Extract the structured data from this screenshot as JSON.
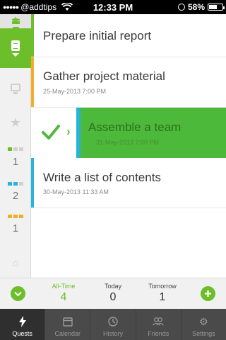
{
  "status_bar": {
    "carrier": "@addtips",
    "time": "12:33 PM",
    "battery": "58%"
  },
  "tasks": [
    {
      "title": "Prepare initial report",
      "date": "",
      "stripe_color": "#6cbf2a"
    },
    {
      "title": "Gather project material",
      "date": "25-May-2013 7:00 PM",
      "stripe_color": "#f2ae26"
    },
    {
      "title": "Assemble a team",
      "date": "31-May-2013 7:00 PM",
      "stripe_color": "#2bb3d6",
      "completed": true
    },
    {
      "title": "Write a list of contents",
      "date": "30-May-2013 11:33 AM",
      "stripe_color": "#2bb3d6"
    }
  ],
  "sidebar": {
    "counts": [
      "1",
      "2",
      "1"
    ],
    "icons": [
      "menu-icon",
      "quest-document-icon",
      "monitor-icon",
      "star-icon",
      "star-icon",
      "folder-icon",
      "house-icon"
    ]
  },
  "summary": {
    "all_time": {
      "label": "All-Time",
      "value": "4"
    },
    "today": {
      "label": "Today",
      "value": "0"
    },
    "tomorrow": {
      "label": "Tomorrow",
      "value": "1"
    }
  },
  "tabs": [
    {
      "label": "Quests",
      "icon": "lightning-icon",
      "active": true
    },
    {
      "label": "Calendar",
      "icon": "calendar-icon"
    },
    {
      "label": "History",
      "icon": "clock-icon"
    },
    {
      "label": "Friends",
      "icon": "friends-icon"
    },
    {
      "label": "Settings",
      "icon": "gear-icon"
    }
  ],
  "colors": {
    "accent": "#6cbf2a",
    "done_card": "#4cb93a",
    "orange": "#f2ae26",
    "blue": "#2bb3d6"
  }
}
